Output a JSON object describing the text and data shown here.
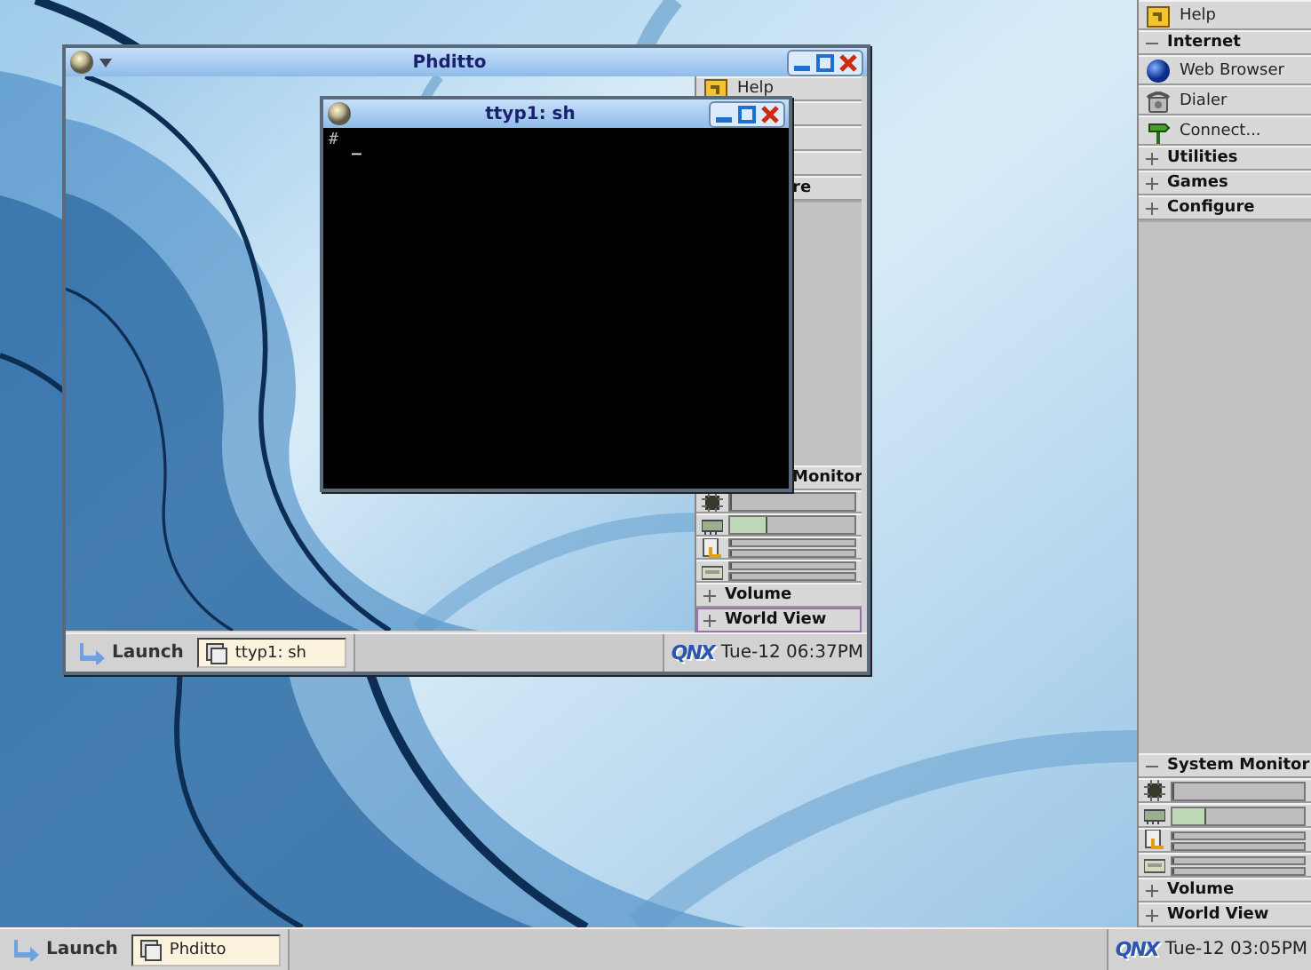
{
  "desktop": {
    "phditto_window": {
      "title": "Phditto",
      "shelf": {
        "top": [
          {
            "kind": "help",
            "label": "Help"
          },
          {
            "kind": "blank"
          },
          {
            "kind": "blank"
          },
          {
            "kind": "blank"
          },
          {
            "kind": "cut",
            "label": "re"
          }
        ],
        "bottom": [
          {
            "kind": "cut",
            "label": "Monitor"
          },
          {
            "kind": "cpu",
            "level": 0
          },
          {
            "kind": "memory",
            "level": 0.3
          },
          {
            "kind": "disk",
            "bars": [
              {
                "level": 0
              },
              {
                "level": 0
              }
            ]
          },
          {
            "kind": "swap",
            "bars": [
              {
                "level": 0
              },
              {
                "level": 0
              }
            ]
          },
          {
            "kind": "group",
            "label": "Volume",
            "expanded": false,
            "selected": false
          },
          {
            "kind": "group",
            "label": "World View",
            "expanded": false,
            "selected": true
          }
        ]
      },
      "taskbar": {
        "launch": "Launch",
        "tasks": [
          {
            "label": "ttyp1: sh",
            "selected": true
          }
        ],
        "logo": "QNX",
        "clock": "Tue-12 06:37PM"
      }
    },
    "terminal_window": {
      "title": "ttyp1: sh",
      "prompt": "#",
      "cursor": "_"
    }
  },
  "shelf": {
    "top": [
      {
        "kind": "help",
        "label": "Help"
      },
      {
        "kind": "group",
        "label": "Internet",
        "expanded": true
      },
      {
        "kind": "browser",
        "label": "Web Browser"
      },
      {
        "kind": "phone",
        "label": "Dialer"
      },
      {
        "kind": "signpost",
        "label": "Connect..."
      },
      {
        "kind": "group",
        "label": "Utilities",
        "expanded": false
      },
      {
        "kind": "group",
        "label": "Games",
        "expanded": false
      },
      {
        "kind": "group",
        "label": "Configure",
        "expanded": false
      }
    ],
    "bottom": [
      {
        "kind": "group",
        "label": "System Monitor",
        "expanded": true
      },
      {
        "kind": "cpu",
        "level": 0
      },
      {
        "kind": "memory",
        "level": 0.25
      },
      {
        "kind": "disk",
        "bars": [
          {
            "level": 0
          },
          {
            "level": 0
          }
        ]
      },
      {
        "kind": "swap",
        "bars": [
          {
            "level": 0
          },
          {
            "level": 0
          }
        ]
      },
      {
        "kind": "group",
        "label": "Volume",
        "expanded": false
      },
      {
        "kind": "group",
        "label": "World View",
        "expanded": false
      }
    ]
  },
  "taskbar": {
    "launch": "Launch",
    "tasks": [
      {
        "label": "Phditto",
        "selected": true
      }
    ],
    "logo": "QNX",
    "clock": "Tue-12 03:05PM"
  }
}
